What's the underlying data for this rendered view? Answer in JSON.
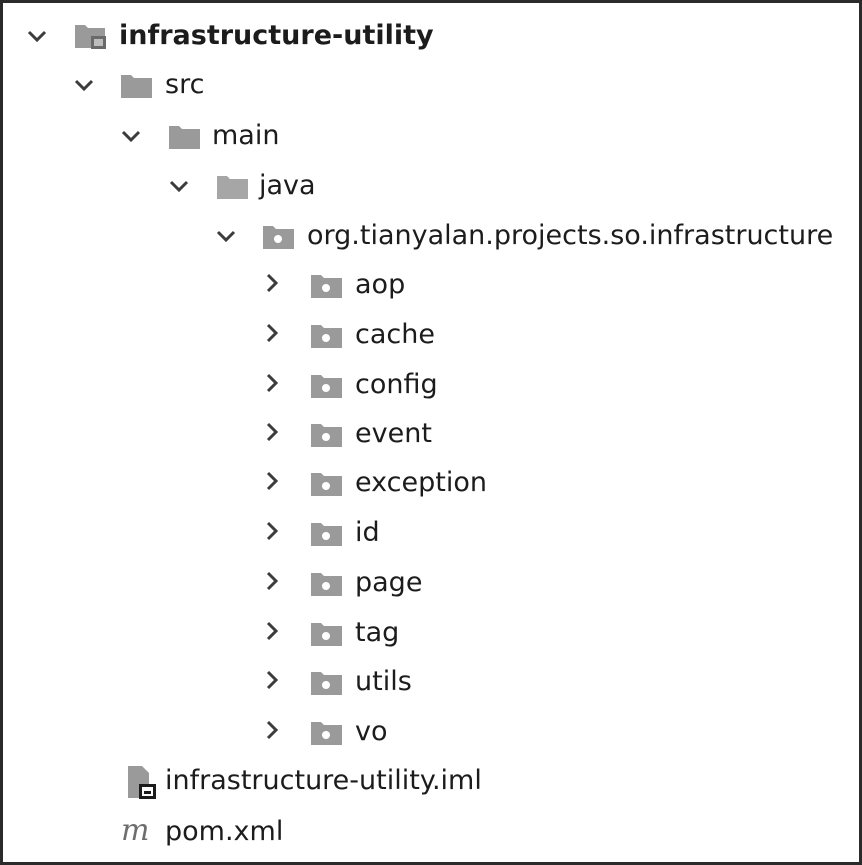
{
  "tree": {
    "root": {
      "label": "infrastructure-utility",
      "expanded": true
    },
    "src": {
      "label": "src",
      "expanded": true
    },
    "main": {
      "label": "main",
      "expanded": true
    },
    "java": {
      "label": "java",
      "expanded": true
    },
    "package": {
      "label": "org.tianyalan.projects.so.infrastructure",
      "expanded": true
    },
    "packages": [
      {
        "label": "aop"
      },
      {
        "label": "cache"
      },
      {
        "label": "config"
      },
      {
        "label": "event"
      },
      {
        "label": "exception"
      },
      {
        "label": "id"
      },
      {
        "label": "page"
      },
      {
        "label": "tag"
      },
      {
        "label": "utils"
      },
      {
        "label": "vo"
      }
    ],
    "iml": {
      "label": "infrastructure-utility.iml",
      "icon": "iml-file-icon"
    },
    "pom": {
      "label": "pom.xml",
      "icon": "maven-m-icon",
      "glyph": "m"
    }
  },
  "colors": {
    "text": "#1c1c1c",
    "chevron": "#3c3c3c",
    "folder": "#9a9a9a",
    "border": "#2b2b2b"
  }
}
